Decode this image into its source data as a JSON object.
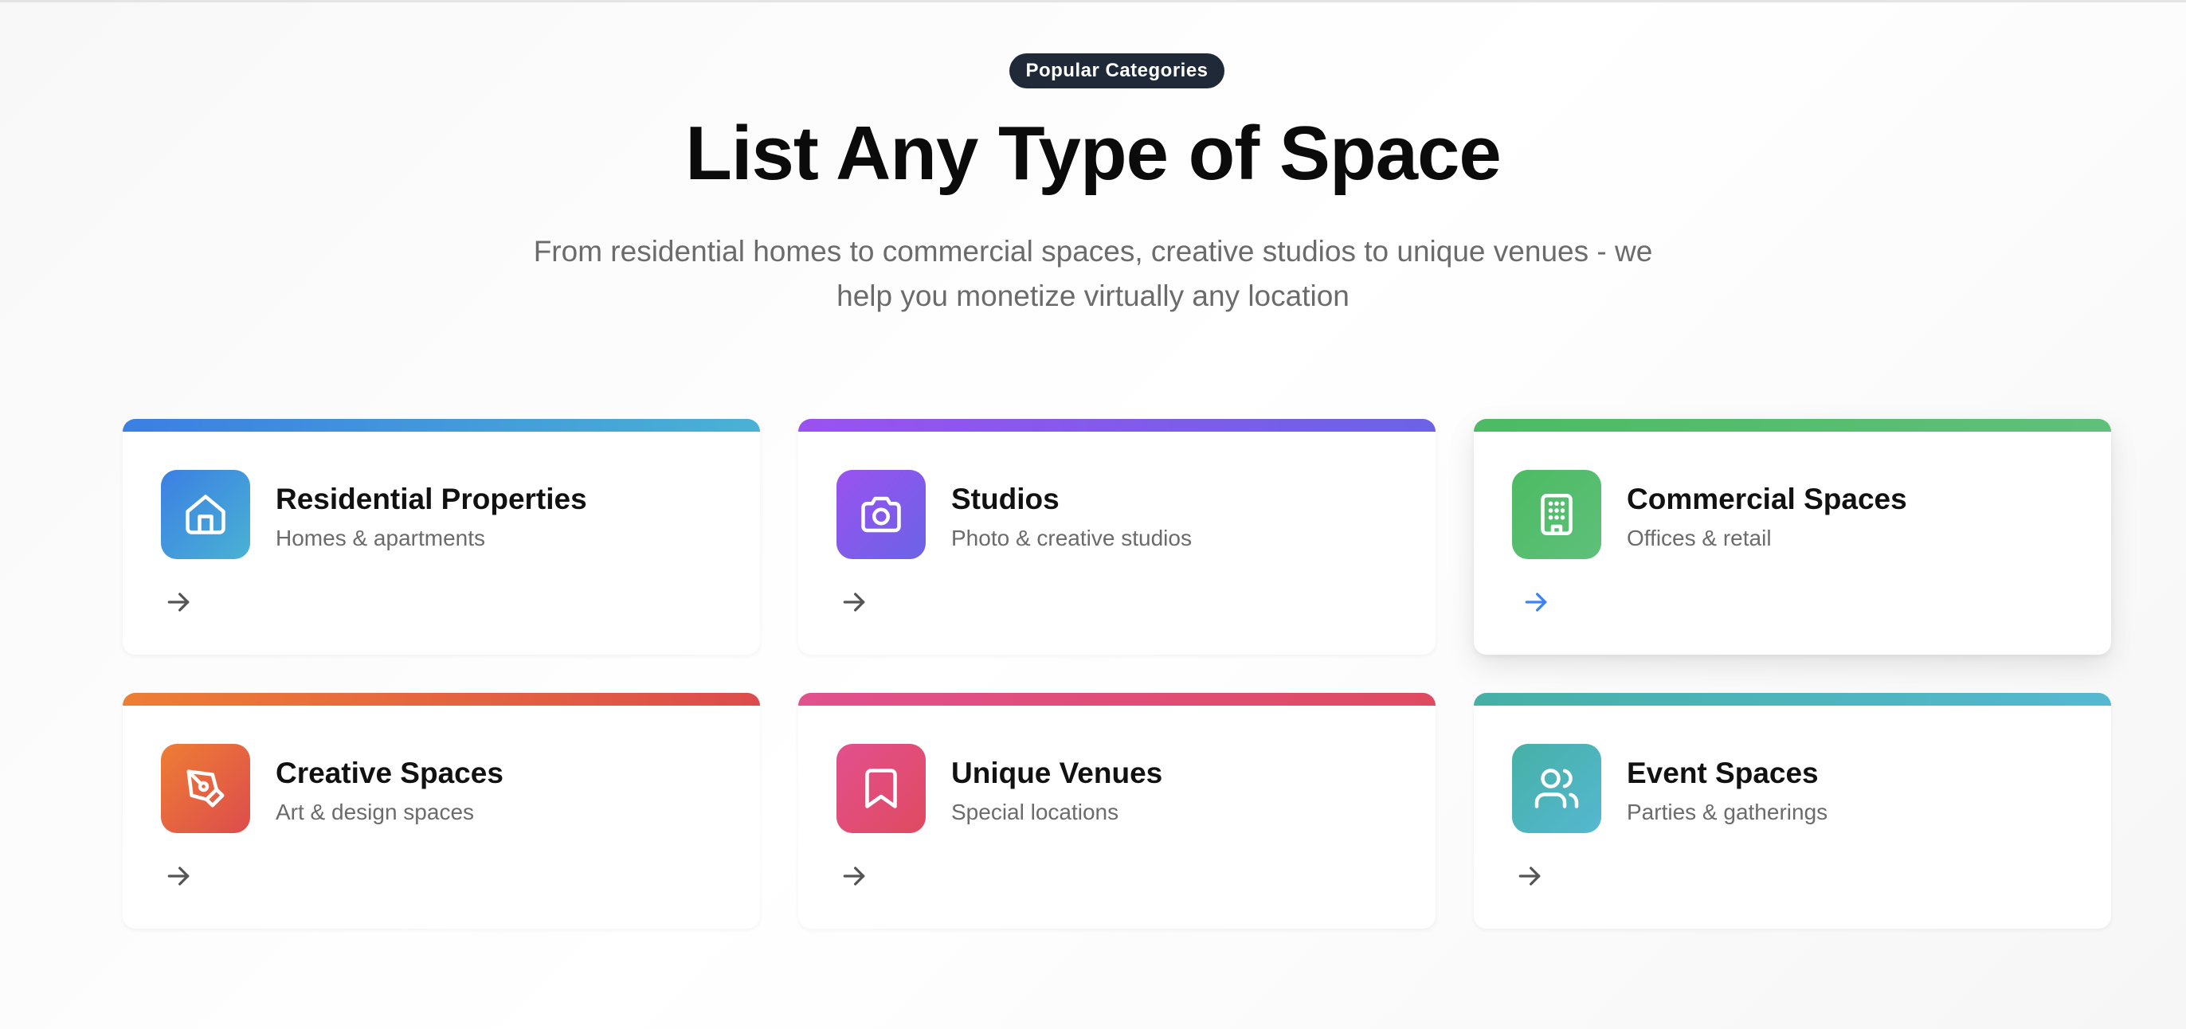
{
  "header": {
    "badge": "Popular Categories",
    "title": "List Any Type of Space",
    "subtitle": "From residential homes to commercial spaces, creative studios to unique venues - we help you monetize virtually any location"
  },
  "categories": [
    {
      "title": "Residential Properties",
      "subtitle": "Homes & apartments",
      "icon": "house-icon",
      "gradient": [
        "#3b7fe3",
        "#4ab2d4"
      ],
      "arrow_color": "#555555"
    },
    {
      "title": "Studios",
      "subtitle": "Photo & creative studios",
      "icon": "camera-icon",
      "gradient": [
        "#9a52f0",
        "#6b63e6"
      ],
      "arrow_color": "#555555"
    },
    {
      "title": "Commercial Spaces",
      "subtitle": "Offices & retail",
      "icon": "building-icon",
      "gradient": [
        "#4cbb63",
        "#5fc07a"
      ],
      "arrow_color": "#3b82f6"
    },
    {
      "title": "Creative Spaces",
      "subtitle": "Art & design spaces",
      "icon": "pen-tool-icon",
      "gradient": [
        "#ee7d34",
        "#dd4c4c"
      ],
      "arrow_color": "#555555"
    },
    {
      "title": "Unique Venues",
      "subtitle": "Special locations",
      "icon": "bookmark-icon",
      "gradient": [
        "#e2508e",
        "#e04a60"
      ],
      "arrow_color": "#555555"
    },
    {
      "title": "Event Spaces",
      "subtitle": "Parties & gatherings",
      "icon": "users-icon",
      "gradient": [
        "#46b0a6",
        "#55b8d1"
      ],
      "arrow_color": "#555555"
    }
  ]
}
